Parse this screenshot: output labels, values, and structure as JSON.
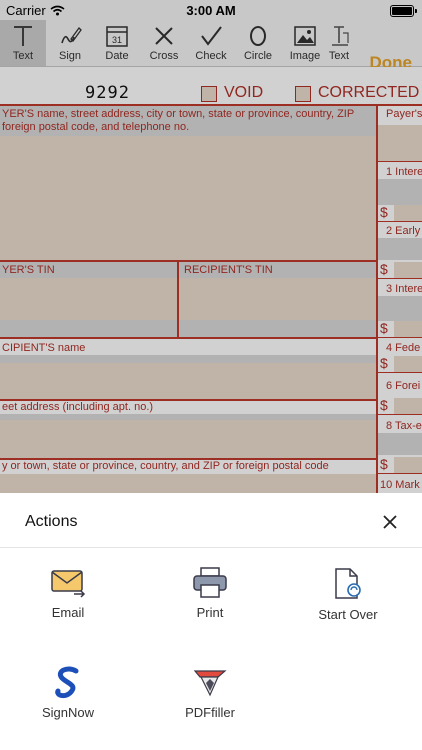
{
  "status": {
    "carrier": "Carrier",
    "time": "3:00 AM"
  },
  "toolbar": {
    "tools": [
      {
        "label": "Text",
        "icon": "text-icon",
        "active": true
      },
      {
        "label": "Sign",
        "icon": "pen-icon"
      },
      {
        "label": "Date",
        "icon": "calendar-icon",
        "day": "31"
      },
      {
        "label": "Cross",
        "icon": "cross-icon"
      },
      {
        "label": "Check",
        "icon": "checkmark-icon"
      },
      {
        "label": "Circle",
        "icon": "circle-icon"
      },
      {
        "label": "Image",
        "icon": "image-icon"
      },
      {
        "label": "Text",
        "icon": "text-field-icon"
      }
    ],
    "done": "Done"
  },
  "form": {
    "number": "9292",
    "void": "VOID",
    "corrected": "CORRECTED",
    "payer_name_label1": "YER'S name, street address, city or town, state or province, country, ZIP",
    "payer_name_label2": "foreign postal code, and telephone no.",
    "payer_right": "Payer's",
    "box1": "1 Intere",
    "box2": "2 Early",
    "payer_tin": "YER'S TIN",
    "recipient_tin": "RECIPIENT'S TIN",
    "box3": "3 Intere",
    "recipient_name": "CIPIENT'S name",
    "box4": "4 Fede",
    "box6": "6 Forei",
    "street": "eet address (including apt. no.)",
    "box8": "8 Tax-e",
    "city": "y or town, state or province, country, and ZIP or foreign postal code",
    "box10": "10 Mark",
    "dollar": "$",
    "colors": {
      "form_red": "#c0392b",
      "field_fill": "#e9dccc",
      "done": "#e6a42a"
    }
  },
  "sheet": {
    "title": "Actions",
    "actions": [
      {
        "label": "Email",
        "icon": "email-icon"
      },
      {
        "label": "Print",
        "icon": "printer-icon"
      },
      {
        "label": "Start Over",
        "icon": "start-over-icon"
      },
      {
        "label": "SignNow",
        "icon": "signnow-logo-icon"
      },
      {
        "label": "PDFfiller",
        "icon": "pdffiller-logo-icon"
      }
    ]
  }
}
